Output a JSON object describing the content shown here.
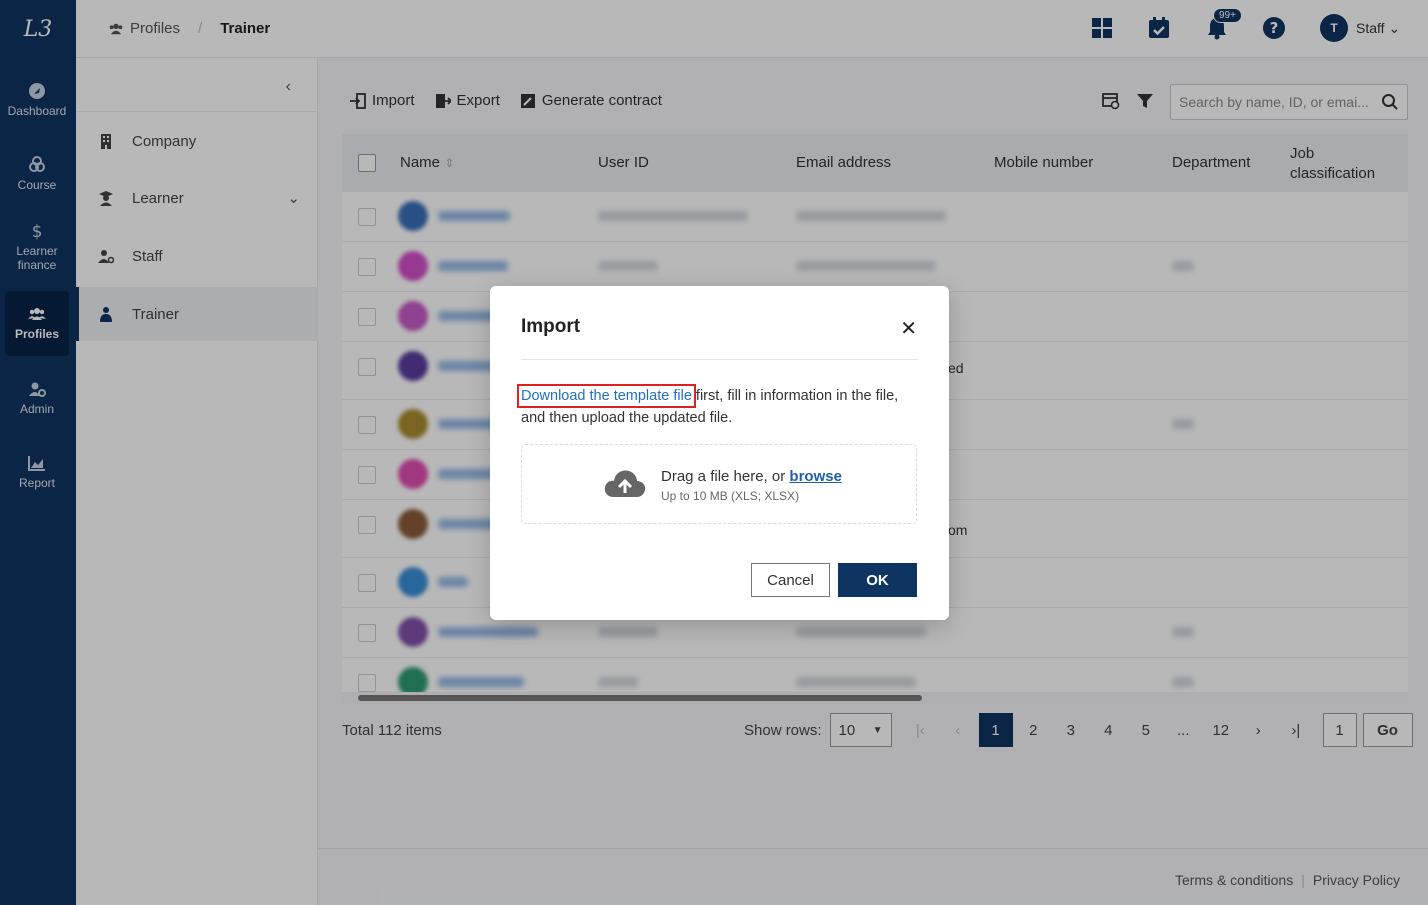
{
  "brand": {
    "logo_text": "L3",
    "primary_color": "#0e3462",
    "link_color": "#1f6fc5",
    "highlight_color": "#e02020"
  },
  "nav": {
    "items": [
      {
        "label": "Dashboard",
        "icon": "dashboard-icon"
      },
      {
        "label": "Course",
        "icon": "course-icon"
      },
      {
        "label": "Learner finance",
        "icon": "dollar-icon"
      },
      {
        "label": "Profiles",
        "icon": "users-icon",
        "active": true
      },
      {
        "label": "Admin",
        "icon": "admin-icon"
      },
      {
        "label": "Report",
        "icon": "chart-icon"
      }
    ]
  },
  "breadcrumb": {
    "parent": "Profiles",
    "separator": "/",
    "current": "Trainer"
  },
  "topbar": {
    "notification_count": "99+",
    "avatar_initial": "T",
    "user_name": "Staff"
  },
  "subnav": {
    "items": [
      {
        "label": "Company"
      },
      {
        "label": "Learner"
      },
      {
        "label": "Staff"
      },
      {
        "label": "Trainer",
        "active": true
      }
    ]
  },
  "toolbar": {
    "import_label": "Import",
    "export_label": "Export",
    "contract_label": "Generate contract",
    "search_placeholder": "Search by name, ID, or emai..."
  },
  "table": {
    "headers": [
      "Name",
      "User ID",
      "Email address",
      "Mobile number",
      "Department",
      "Job classification"
    ],
    "row_count": 10,
    "partial_text": {
      "row4": "ed",
      "row7": "om"
    }
  },
  "pagination": {
    "total_label": "Total 112 items",
    "rows_label": "Show rows:",
    "rows_value": "10",
    "pages": [
      "1",
      "2",
      "3",
      "4",
      "5",
      "...",
      "12"
    ],
    "current_page": "1",
    "goto_value": "1",
    "go_label": "Go"
  },
  "footer": {
    "terms": "Terms & conditions",
    "privacy": "Privacy Policy"
  },
  "modal": {
    "title": "Import",
    "close_symbol": "✕",
    "download_link": "Download the template file",
    "desc_rest": " first, fill in information in the file, and then upload the updated file.",
    "drop_text": "Drag a file here, or ",
    "browse_link": "browse",
    "drop_hint": "Up to 10 MB (XLS; XLSX)",
    "cancel_label": "Cancel",
    "ok_label": "OK"
  }
}
